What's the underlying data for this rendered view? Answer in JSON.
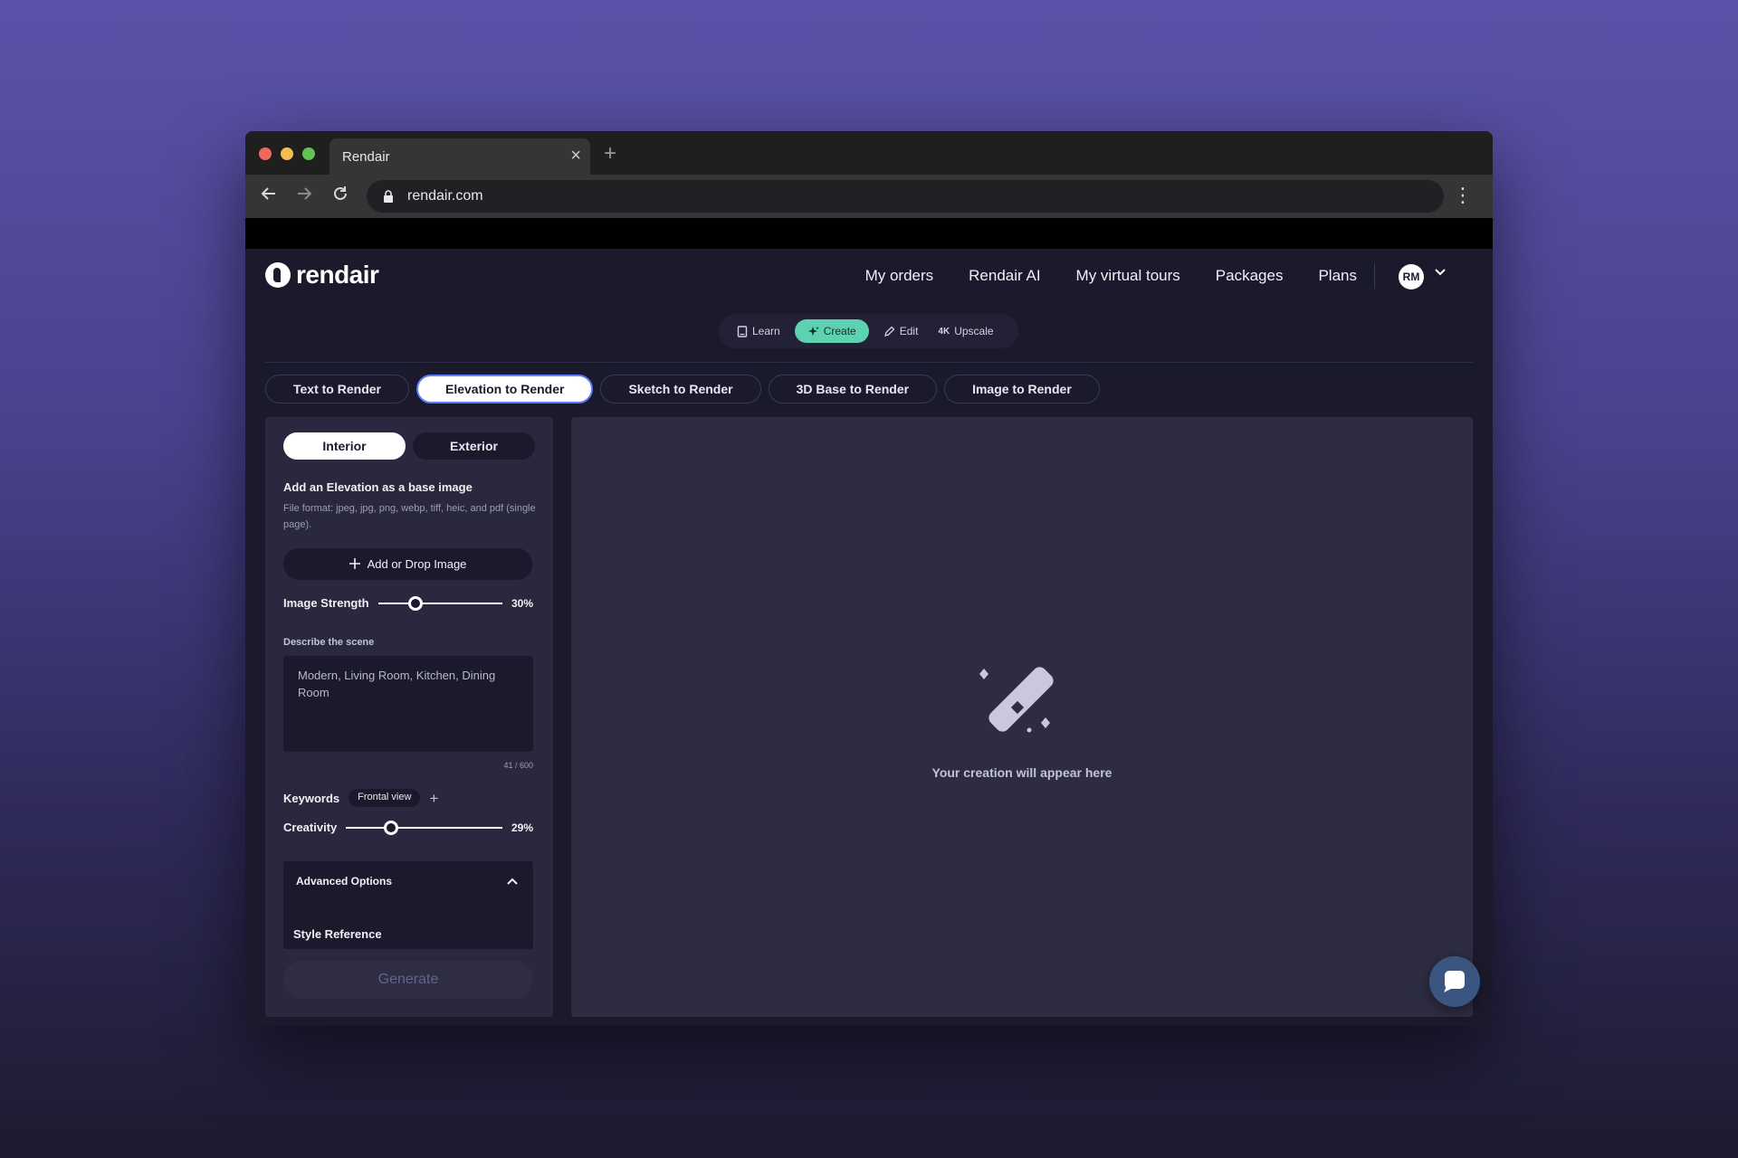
{
  "browser": {
    "tab_title": "Rendair",
    "url": "rendair.com"
  },
  "app": {
    "logo_text": "rendair",
    "nav": [
      "My orders",
      "Rendair AI",
      "My virtual tours",
      "Packages",
      "Plans"
    ],
    "avatar_initials": "RM",
    "modes": [
      {
        "label": "Learn"
      },
      {
        "label": "Create"
      },
      {
        "label": "Edit"
      },
      {
        "label": "Upscale"
      }
    ],
    "render_tabs": [
      "Text to Render",
      "Elevation to Render",
      "Sketch to Render",
      "3D Base to Render",
      "Image to Render"
    ],
    "active_render_tab": "Elevation to Render"
  },
  "panel": {
    "segments": [
      "Interior",
      "Exterior"
    ],
    "active_segment": "Interior",
    "add_title": "Add an Elevation as a base image",
    "add_hint": "File format: jpeg, jpg, png, webp, tiff, heic, and pdf (single page).",
    "add_button": "Add or Drop Image",
    "image_strength": {
      "label": "Image Strength",
      "value_text": "30%",
      "value": 30
    },
    "describe_label": "Describe the scene",
    "describe_placeholder": "Modern, Living Room, Kitchen, Dining Room",
    "char_counter": "41 / 600",
    "keywords_label": "Keywords",
    "keywords": [
      "Frontal view"
    ],
    "creativity": {
      "label": "Creativity",
      "value_text": "29%",
      "value": 29
    },
    "advanced_title": "Advanced Options",
    "style_reference": "Style Reference",
    "generate_button": "Generate"
  },
  "canvas": {
    "empty_message": "Your creation will appear here"
  },
  "colors": {
    "accent": "#5ed1b0",
    "active_tab_border": "#5b7cff",
    "bg": "#1b1a2d"
  }
}
